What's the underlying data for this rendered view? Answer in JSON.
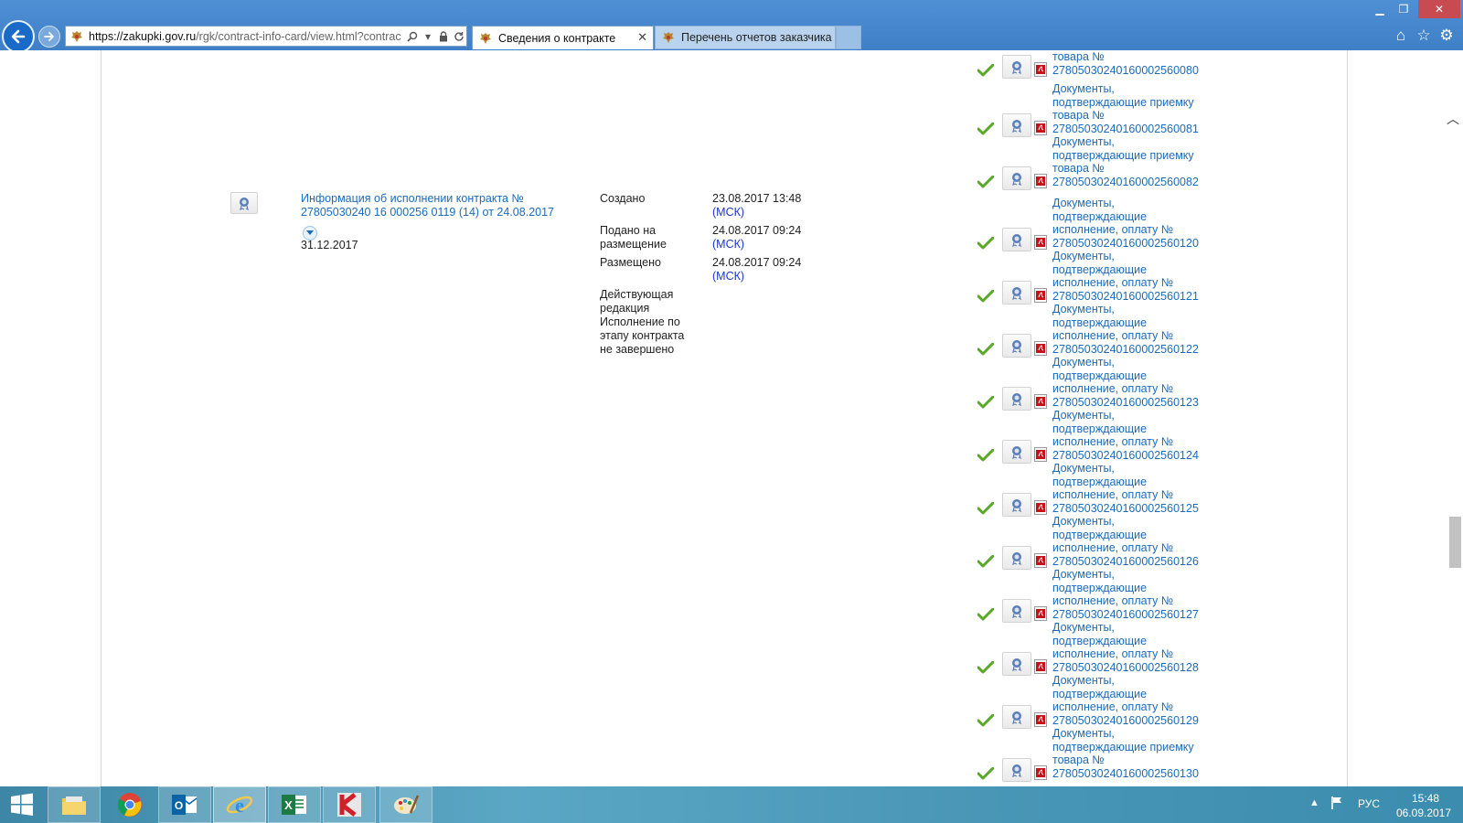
{
  "browser": {
    "address": {
      "host": "https://zakupki.gov.ru",
      "path": "/rgk/contract-info-card/view.html?contrac"
    },
    "tabs": [
      {
        "label": "Сведения о контракте",
        "active": true
      },
      {
        "label": "Перечень отчетов заказчика",
        "active": false
      }
    ]
  },
  "main": {
    "info_link_line1": "Информация об исполнении контракта №",
    "info_link_line2": "27805030240 16 000256 0119 (14) от 24.08.2017",
    "end_date": "31.12.2017",
    "status_rows": [
      {
        "label_line1": "Создано",
        "label_line2": "",
        "value": "23.08.2017 13:48",
        "tz": "(МСК)"
      },
      {
        "label_line1": "Подано на",
        "label_line2": "размещение",
        "value": "24.08.2017 09:24",
        "tz": "(МСК)"
      },
      {
        "label_line1": "Размещено",
        "label_line2": "",
        "value": "24.08.2017 09:24",
        "tz": "(МСК)"
      }
    ],
    "edition_lines": [
      "Действующая",
      "редакция",
      "Исполнение по",
      "этапу контракта",
      "не завершено"
    ]
  },
  "documents": [
    {
      "lines": [
        "товара №",
        "27805030240160002560080"
      ]
    },
    {
      "lines": [
        "Документы,",
        "подтверждающие приемку",
        "товара №",
        "27805030240160002560081"
      ]
    },
    {
      "lines": [
        "Документы,",
        "подтверждающие приемку",
        "товара №",
        "27805030240160002560082"
      ]
    },
    {
      "lines": [
        "Документы,",
        "подтверждающие",
        "исполнение, оплату №",
        "27805030240160002560120"
      ]
    },
    {
      "lines": [
        "Документы,",
        "подтверждающие",
        "исполнение, оплату №",
        "27805030240160002560121"
      ]
    },
    {
      "lines": [
        "Документы,",
        "подтверждающие",
        "исполнение, оплату №",
        "27805030240160002560122"
      ]
    },
    {
      "lines": [
        "Документы,",
        "подтверждающие",
        "исполнение, оплату №",
        "27805030240160002560123"
      ]
    },
    {
      "lines": [
        "Документы,",
        "подтверждающие",
        "исполнение, оплату №",
        "27805030240160002560124"
      ]
    },
    {
      "lines": [
        "Документы,",
        "подтверждающие",
        "исполнение, оплату №",
        "27805030240160002560125"
      ]
    },
    {
      "lines": [
        "Документы,",
        "подтверждающие",
        "исполнение, оплату №",
        "27805030240160002560126"
      ]
    },
    {
      "lines": [
        "Документы,",
        "подтверждающие",
        "исполнение, оплату №",
        "27805030240160002560127"
      ]
    },
    {
      "lines": [
        "Документы,",
        "подтверждающие",
        "исполнение, оплату №",
        "27805030240160002560128"
      ]
    },
    {
      "lines": [
        "Документы,",
        "подтверждающие",
        "исполнение, оплату №",
        "27805030240160002560129"
      ]
    },
    {
      "lines": [
        "Документы,",
        "подтверждающие приемку",
        "товара №",
        "27805030240160002560130"
      ]
    }
  ],
  "taskbar": {
    "apps": [
      "file-explorer",
      "chrome",
      "outlook",
      "internet-explorer",
      "excel",
      "kaspersky",
      "paint"
    ],
    "active_app": "internet-explorer",
    "language": "РУС",
    "time": "15:48",
    "date": "06.09.2017"
  },
  "colors": {
    "link": "#1c6bb8",
    "msk": "#1c36c8",
    "check": "#5aa82a",
    "pdf": "#c8101a",
    "chrome_bar": "#4a8cd2"
  }
}
